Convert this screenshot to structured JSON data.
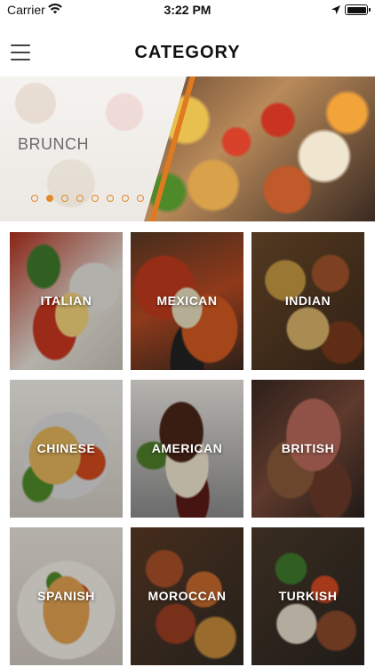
{
  "status_bar": {
    "carrier": "Carrier",
    "time": "3:22 PM"
  },
  "header": {
    "title": "CATEGORY"
  },
  "banner": {
    "label": "BRUNCH",
    "dots_total": 8,
    "active_index": 1
  },
  "categories": [
    {
      "label": "ITALIAN"
    },
    {
      "label": "MEXICAN"
    },
    {
      "label": "INDIAN"
    },
    {
      "label": "CHINESE"
    },
    {
      "label": "AMERICAN"
    },
    {
      "label": "BRITISH"
    },
    {
      "label": "SPANISH"
    },
    {
      "label": "MOROCCAN"
    },
    {
      "label": "TURKISH"
    }
  ],
  "colors": {
    "accent": "#e08a2a"
  }
}
